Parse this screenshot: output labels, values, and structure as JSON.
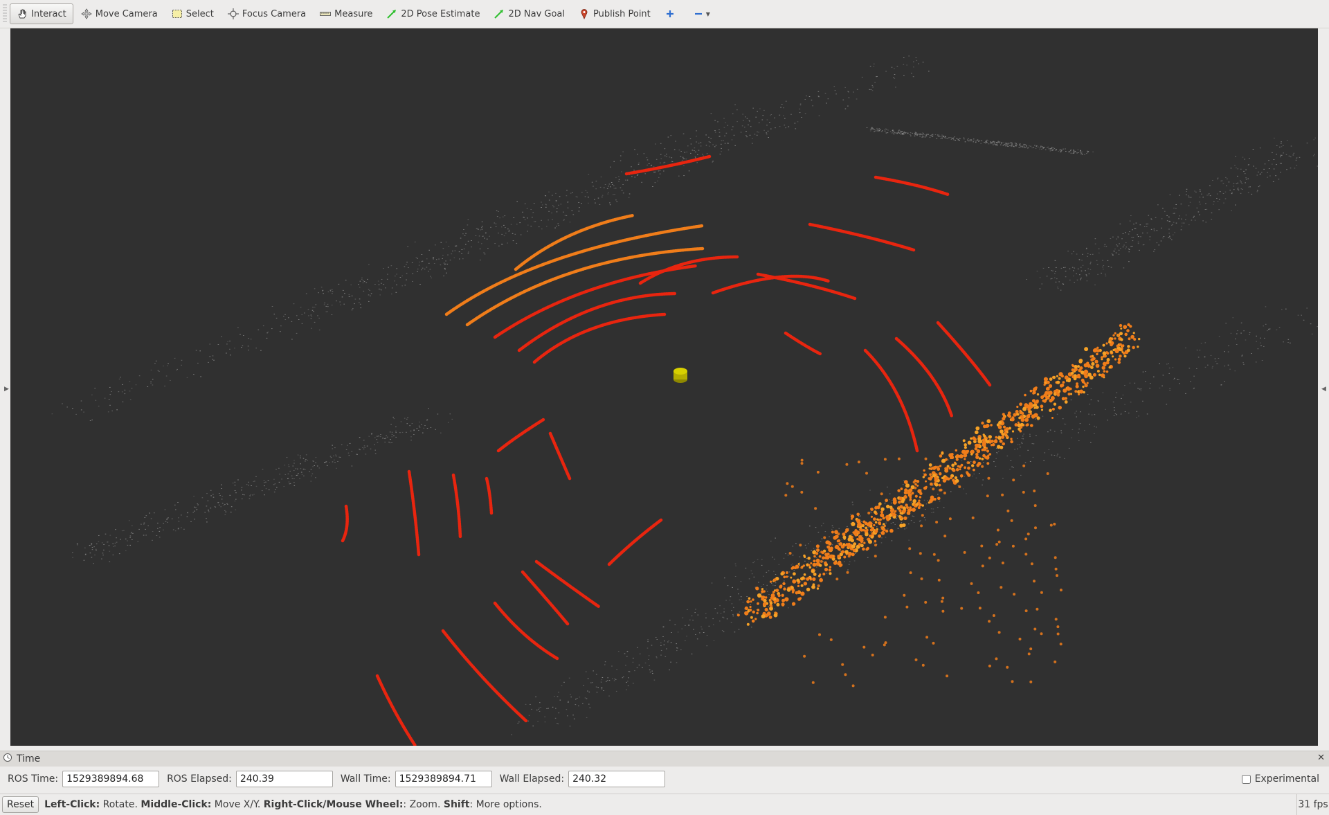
{
  "toolbar": {
    "tools": [
      {
        "label": "Interact",
        "icon": "hand-icon"
      },
      {
        "label": "Move Camera",
        "icon": "move-camera-icon"
      },
      {
        "label": "Select",
        "icon": "select-icon"
      },
      {
        "label": "Focus Camera",
        "icon": "focus-camera-icon"
      },
      {
        "label": "Measure",
        "icon": "ruler-icon"
      },
      {
        "label": "2D Pose Estimate",
        "icon": "green-arrow-icon"
      },
      {
        "label": "2D Nav Goal",
        "icon": "green-arrow-icon"
      },
      {
        "label": "Publish Point",
        "icon": "map-pin-icon"
      }
    ],
    "add_tool_icon": "plus-icon",
    "remove_tool_icon": "minus-icon"
  },
  "colors": {
    "viewport_bg": "#303030",
    "scan_red": "#e8250f",
    "scan_orange": "#f07d1a",
    "robot_yellow": "#c8c000",
    "cloud_gray": "#9a9a9a"
  },
  "time_panel": {
    "title": "Time",
    "ros_time_label": "ROS Time:",
    "ros_time_value": "1529389894.68",
    "ros_elapsed_label": "ROS Elapsed:",
    "ros_elapsed_value": "240.39",
    "wall_time_label": "Wall Time:",
    "wall_time_value": "1529389894.71",
    "wall_elapsed_label": "Wall Elapsed:",
    "wall_elapsed_value": "240.32",
    "experimental_label": "Experimental",
    "experimental_checked": false
  },
  "status_bar": {
    "reset_label": "Reset",
    "hint_parts": [
      {
        "bold": "Left-Click:",
        "text": " Rotate. "
      },
      {
        "bold": "Middle-Click:",
        "text": " Move X/Y. "
      },
      {
        "bold": "Right-Click/Mouse Wheel:",
        "text": ": Zoom. "
      },
      {
        "bold": "Shift",
        "text": ": More options."
      }
    ],
    "fps": "31 fps"
  }
}
